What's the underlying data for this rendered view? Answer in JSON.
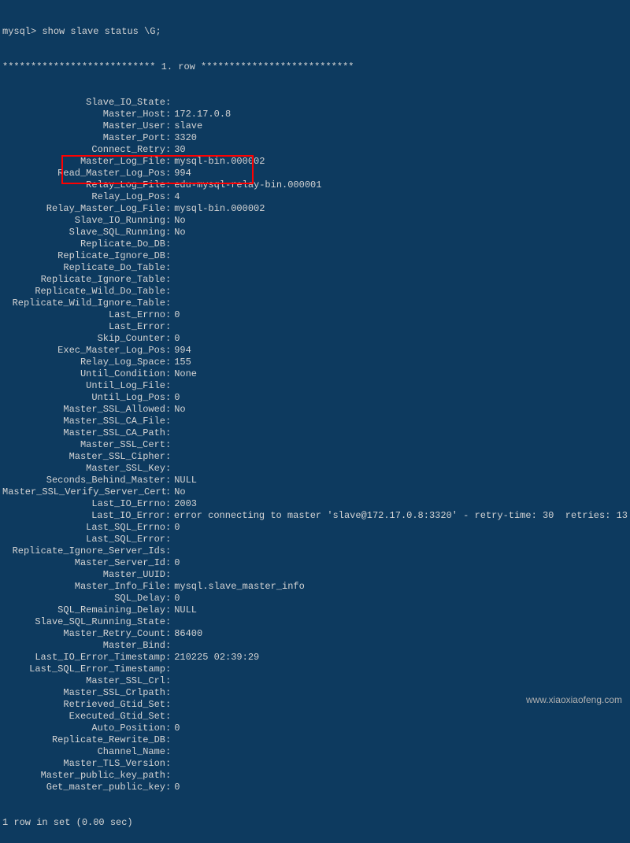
{
  "prompt": "mysql> ",
  "command": "show slave status \\G;",
  "row_header": "*************************** 1. row ***************************",
  "footer": "1 row in set (0.00 sec)",
  "watermark": "www.xiaoxiaofeng.com",
  "fields": [
    {
      "label": "Slave_IO_State",
      "value": ""
    },
    {
      "label": "Master_Host",
      "value": "172.17.0.8"
    },
    {
      "label": "Master_User",
      "value": "slave"
    },
    {
      "label": "Master_Port",
      "value": "3320"
    },
    {
      "label": "Connect_Retry",
      "value": "30"
    },
    {
      "label": "Master_Log_File",
      "value": "mysql-bin.000002"
    },
    {
      "label": "Read_Master_Log_Pos",
      "value": "994"
    },
    {
      "label": "Relay_Log_File",
      "value": "edu-mysql-relay-bin.000001"
    },
    {
      "label": "Relay_Log_Pos",
      "value": "4"
    },
    {
      "label": "Relay_Master_Log_File",
      "value": "mysql-bin.000002"
    },
    {
      "label": "Slave_IO_Running",
      "value": "No"
    },
    {
      "label": "Slave_SQL_Running",
      "value": "No"
    },
    {
      "label": "Replicate_Do_DB",
      "value": ""
    },
    {
      "label": "Replicate_Ignore_DB",
      "value": ""
    },
    {
      "label": "Replicate_Do_Table",
      "value": ""
    },
    {
      "label": "Replicate_Ignore_Table",
      "value": ""
    },
    {
      "label": "Replicate_Wild_Do_Table",
      "value": ""
    },
    {
      "label": "Replicate_Wild_Ignore_Table",
      "value": ""
    },
    {
      "label": "Last_Errno",
      "value": "0"
    },
    {
      "label": "Last_Error",
      "value": ""
    },
    {
      "label": "Skip_Counter",
      "value": "0"
    },
    {
      "label": "Exec_Master_Log_Pos",
      "value": "994"
    },
    {
      "label": "Relay_Log_Space",
      "value": "155"
    },
    {
      "label": "Until_Condition",
      "value": "None"
    },
    {
      "label": "Until_Log_File",
      "value": ""
    },
    {
      "label": "Until_Log_Pos",
      "value": "0"
    },
    {
      "label": "Master_SSL_Allowed",
      "value": "No"
    },
    {
      "label": "Master_SSL_CA_File",
      "value": ""
    },
    {
      "label": "Master_SSL_CA_Path",
      "value": ""
    },
    {
      "label": "Master_SSL_Cert",
      "value": ""
    },
    {
      "label": "Master_SSL_Cipher",
      "value": ""
    },
    {
      "label": "Master_SSL_Key",
      "value": ""
    },
    {
      "label": "Seconds_Behind_Master",
      "value": "NULL"
    },
    {
      "label": "Master_SSL_Verify_Server_Cert",
      "value": "No"
    },
    {
      "label": "Last_IO_Errno",
      "value": "2003"
    },
    {
      "label": "Last_IO_Error",
      "value": "error connecting to master 'slave@172.17.0.8:3320' - retry-time: 30  retries: 13"
    },
    {
      "label": "Last_SQL_Errno",
      "value": "0"
    },
    {
      "label": "Last_SQL_Error",
      "value": ""
    },
    {
      "label": "Replicate_Ignore_Server_Ids",
      "value": ""
    },
    {
      "label": "Master_Server_Id",
      "value": "0"
    },
    {
      "label": "Master_UUID",
      "value": ""
    },
    {
      "label": "Master_Info_File",
      "value": "mysql.slave_master_info"
    },
    {
      "label": "SQL_Delay",
      "value": "0"
    },
    {
      "label": "SQL_Remaining_Delay",
      "value": "NULL"
    },
    {
      "label": "Slave_SQL_Running_State",
      "value": ""
    },
    {
      "label": "Master_Retry_Count",
      "value": "86400"
    },
    {
      "label": "Master_Bind",
      "value": ""
    },
    {
      "label": "Last_IO_Error_Timestamp",
      "value": "210225 02:39:29"
    },
    {
      "label": "Last_SQL_Error_Timestamp",
      "value": ""
    },
    {
      "label": "Master_SSL_Crl",
      "value": ""
    },
    {
      "label": "Master_SSL_Crlpath",
      "value": ""
    },
    {
      "label": "Retrieved_Gtid_Set",
      "value": ""
    },
    {
      "label": "Executed_Gtid_Set",
      "value": ""
    },
    {
      "label": "Auto_Position",
      "value": "0"
    },
    {
      "label": "Replicate_Rewrite_DB",
      "value": ""
    },
    {
      "label": "Channel_Name",
      "value": ""
    },
    {
      "label": "Master_TLS_Version",
      "value": ""
    },
    {
      "label": "Master_public_key_path",
      "value": ""
    },
    {
      "label": "Get_master_public_key",
      "value": "0"
    }
  ]
}
